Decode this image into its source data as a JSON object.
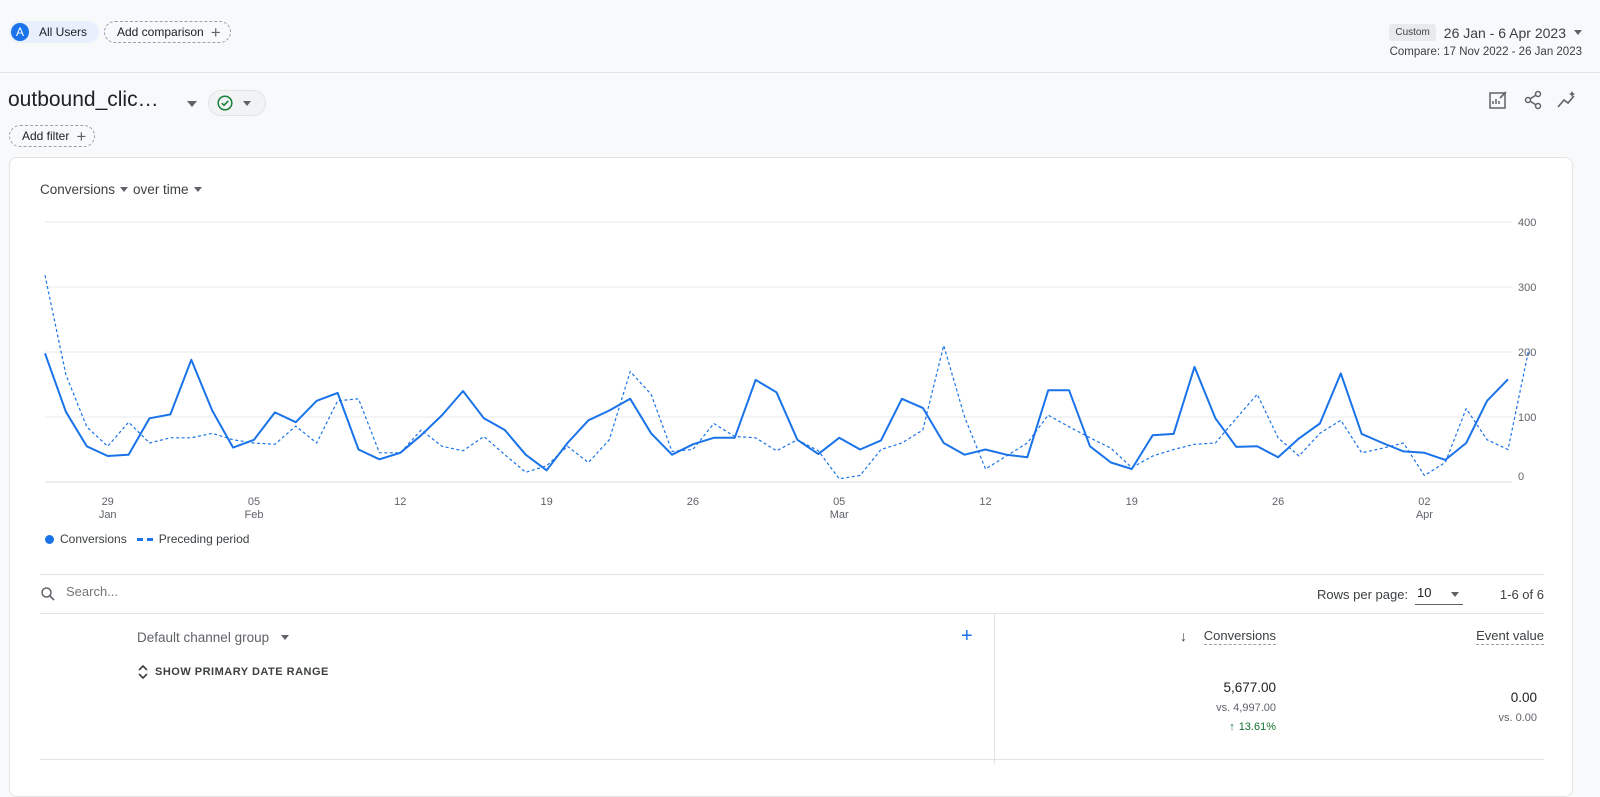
{
  "header": {
    "segment_initial": "A",
    "segment_label": "All Users",
    "add_comparison_label": "Add comparison",
    "date_badge": "Custom",
    "date_range": "26 Jan - 6 Apr 2023",
    "compare_range": "Compare: 17 Nov 2022 - 26 Jan 2023"
  },
  "report": {
    "event_title": "outbound_clic…",
    "add_filter_label": "Add filter",
    "toolbar_icons": [
      "edit-chart-icon",
      "share-icon",
      "insights-icon"
    ]
  },
  "chart_header": {
    "metric": "Conversions",
    "dimension": "over time"
  },
  "legend": {
    "primary": "Conversions",
    "comparison": "Preceding period"
  },
  "chart_data": {
    "type": "line",
    "x_tick_labels": [
      {
        "day": "29",
        "month": "Jan"
      },
      {
        "day": "05",
        "month": "Feb"
      },
      {
        "day": "12",
        "month": ""
      },
      {
        "day": "19",
        "month": ""
      },
      {
        "day": "26",
        "month": ""
      },
      {
        "day": "05",
        "month": "Mar"
      },
      {
        "day": "12",
        "month": ""
      },
      {
        "day": "19",
        "month": ""
      },
      {
        "day": "26",
        "month": ""
      },
      {
        "day": "02",
        "month": "Apr"
      }
    ],
    "x_tick_positions_days": [
      3,
      10,
      17,
      24,
      31,
      38,
      45,
      52,
      59,
      66
    ],
    "y_ticks": [
      "0",
      "100",
      "200",
      "300",
      "400"
    ],
    "ylim": [
      0,
      400
    ],
    "series": [
      {
        "name": "Conversions",
        "style": "solid",
        "color": "#1a73e8",
        "values": [
          198,
          108,
          55,
          40,
          42,
          98,
          104,
          188,
          110,
          53,
          65,
          107,
          92,
          125,
          137,
          50,
          35,
          45,
          72,
          103,
          140,
          98,
          80,
          42,
          18,
          60,
          95,
          110,
          128,
          75,
          42,
          58,
          68,
          68,
          157,
          138,
          65,
          43,
          68,
          50,
          64,
          128,
          114,
          60,
          42,
          50,
          42,
          38,
          141,
          141,
          55,
          30,
          20,
          72,
          74,
          177,
          98,
          54,
          55,
          38,
          67,
          90,
          167,
          74,
          60,
          47,
          45,
          34,
          60,
          125,
          158
        ]
      },
      {
        "name": "Preceding period",
        "style": "dashed",
        "color": "#1a73e8",
        "values": [
          318,
          165,
          85,
          55,
          92,
          60,
          68,
          68,
          75,
          65,
          60,
          58,
          86,
          60,
          125,
          128,
          45,
          45,
          80,
          55,
          48,
          70,
          42,
          15,
          25,
          55,
          30,
          65,
          170,
          135,
          47,
          50,
          90,
          70,
          68,
          48,
          65,
          48,
          5,
          10,
          50,
          60,
          80,
          210,
          100,
          20,
          40,
          60,
          103,
          85,
          68,
          52,
          22,
          40,
          50,
          58,
          60,
          98,
          135,
          68,
          40,
          75,
          95,
          45,
          52,
          60,
          10,
          30,
          113,
          65,
          50,
          205
        ]
      }
    ]
  },
  "table": {
    "search_placeholder": "Search...",
    "rows_per_page_label": "Rows per page:",
    "rows_per_page_value": "10",
    "page_info": "1-6 of 6",
    "dimension_header": "Default channel group",
    "add_column_label": "+",
    "show_range_label": "SHOW PRIMARY DATE RANGE",
    "columns": [
      {
        "label": "Conversions",
        "sorted": "desc",
        "total": "5,677.00",
        "compare": "vs. 4,997.00",
        "change": "13.61%"
      },
      {
        "label": "Event value",
        "total": "0.00",
        "compare": "vs. 0.00"
      }
    ]
  }
}
